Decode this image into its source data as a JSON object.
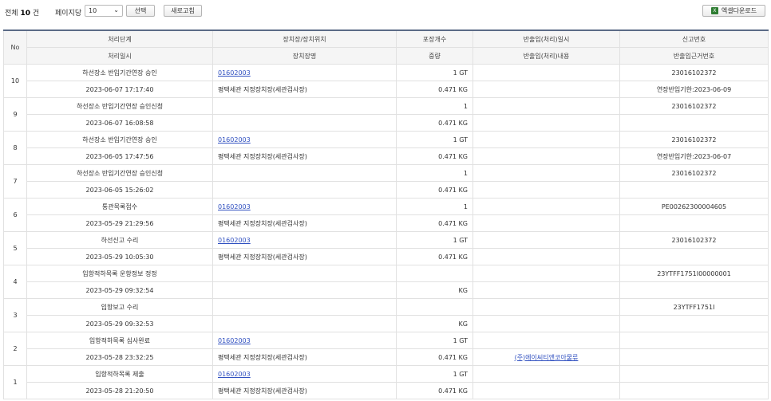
{
  "toolbar": {
    "total_prefix": "전체",
    "total_count": "10",
    "total_suffix": "건",
    "per_page_label": "페이지당",
    "per_page_value": "10",
    "select_label": "선택",
    "refresh_label": "새로고침",
    "excel_label": "엑셀다운로드"
  },
  "headers": {
    "no": "No",
    "stage": "처리단계",
    "stage_date": "처리일시",
    "location": "장치장/장치위치",
    "location_name": "장치장명",
    "packages": "포장개수",
    "weight": "중량",
    "inout_date": "반출입(처리)일시",
    "inout_content": "반출입(처리)내용",
    "report_no": "신고번호",
    "basis_no": "반출입근거번호"
  },
  "rows": [
    {
      "no": "10",
      "stage": "하선장소 반입기간연장 승인",
      "date": "2023-06-07 17:17:40",
      "loc_code": "01602003",
      "loc_name": "평택세관 지정장치장(세관검사장)",
      "packages": "1 GT",
      "weight": "0.471 KG",
      "inout_date": "",
      "inout_content": "",
      "report_no": "23016102372",
      "basis_no": "연장반입기한:2023-06-09"
    },
    {
      "no": "9",
      "stage": "하선장소 반입기간연장 승인신청",
      "date": "2023-06-07 16:08:58",
      "loc_code": "",
      "loc_name": "",
      "packages": "1",
      "weight": "0.471 KG",
      "inout_date": "",
      "inout_content": "",
      "report_no": "23016102372",
      "basis_no": ""
    },
    {
      "no": "8",
      "stage": "하선장소 반입기간연장 승인",
      "date": "2023-06-05 17:47:56",
      "loc_code": "01602003",
      "loc_name": "평택세관 지정장치장(세관검사장)",
      "packages": "1 GT",
      "weight": "0.471 KG",
      "inout_date": "",
      "inout_content": "",
      "report_no": "23016102372",
      "basis_no": "연장반입기한:2023-06-07"
    },
    {
      "no": "7",
      "stage": "하선장소 반입기간연장 승인신청",
      "date": "2023-06-05 15:26:02",
      "loc_code": "",
      "loc_name": "",
      "packages": "1",
      "weight": "0.471 KG",
      "inout_date": "",
      "inout_content": "",
      "report_no": "23016102372",
      "basis_no": ""
    },
    {
      "no": "6",
      "stage": "통관목록접수",
      "date": "2023-05-29 21:29:56",
      "loc_code": "01602003",
      "loc_name": "평택세관 지정장치장(세관검사장)",
      "packages": "1",
      "weight": "0.471 KG",
      "inout_date": "",
      "inout_content": "",
      "report_no": "PE00262300004605",
      "basis_no": ""
    },
    {
      "no": "5",
      "stage": "하선신고 수리",
      "date": "2023-05-29 10:05:30",
      "loc_code": "01602003",
      "loc_name": "평택세관 지정장치장(세관검사장)",
      "packages": "1 GT",
      "weight": "0.471 KG",
      "inout_date": "",
      "inout_content": "",
      "report_no": "23016102372",
      "basis_no": ""
    },
    {
      "no": "4",
      "stage": "입항적하목록 운항정보 정정",
      "date": "2023-05-29 09:32:54",
      "loc_code": "",
      "loc_name": "",
      "packages": "",
      "weight": "KG",
      "inout_date": "",
      "inout_content": "",
      "report_no": "23YTFF1751I00000001",
      "basis_no": ""
    },
    {
      "no": "3",
      "stage": "입항보고 수리",
      "date": "2023-05-29 09:32:53",
      "loc_code": "",
      "loc_name": "",
      "packages": "",
      "weight": "KG",
      "inout_date": "",
      "inout_content": "",
      "report_no": "23YTFF1751I",
      "basis_no": ""
    },
    {
      "no": "2",
      "stage": "입항적하목록 심사완료",
      "date": "2023-05-28 23:32:25",
      "loc_code": "01602003",
      "loc_name": "평택세관 지정장치장(세관검사장)",
      "packages": "1 GT",
      "weight": "0.471 KG",
      "inout_date": "",
      "inout_content": "(주)에이씨티앤코아물류",
      "report_no": "",
      "basis_no": ""
    },
    {
      "no": "1",
      "stage": "입항적하목록 제출",
      "date": "2023-05-28 21:20:50",
      "loc_code": "01602003",
      "loc_name": "평택세관 지정장치장(세관검사장)",
      "packages": "1 GT",
      "weight": "0.471 KG",
      "inout_date": "",
      "inout_content": "",
      "report_no": "",
      "basis_no": ""
    }
  ]
}
